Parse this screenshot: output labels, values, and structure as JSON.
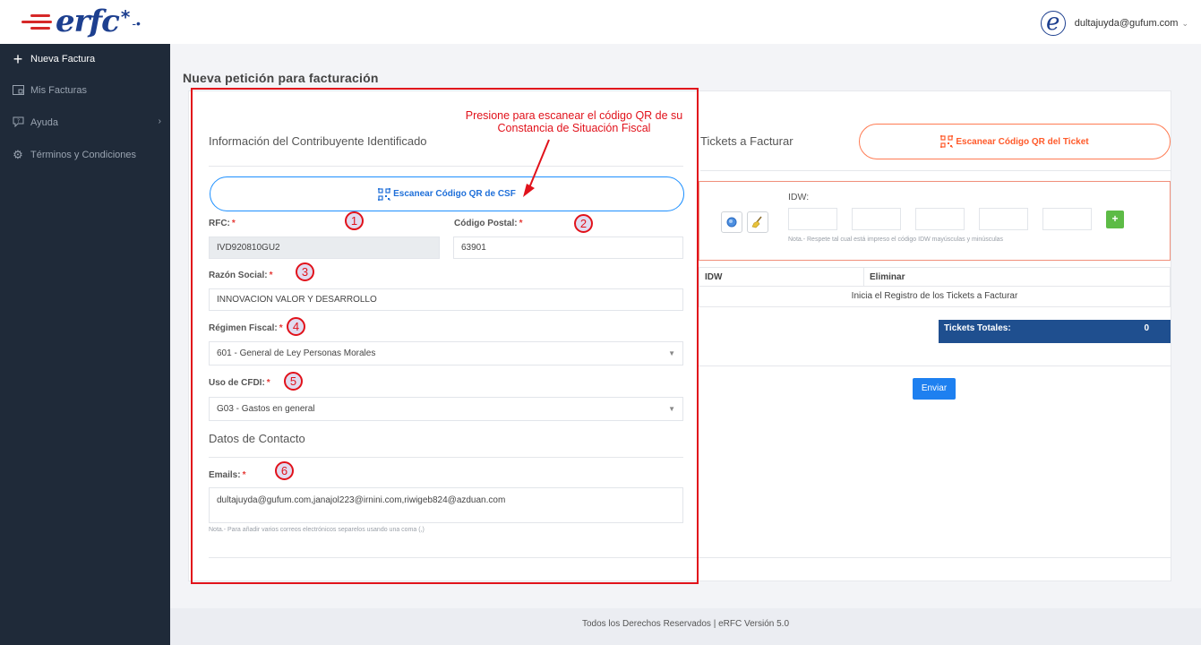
{
  "header": {
    "logo_text": "erfc",
    "logo_star": "*",
    "logo_dot": "-•",
    "user_avatar_letter": "e",
    "user_email": "dultajuyda@gufum.com",
    "user_caret": "⌄"
  },
  "sidebar": {
    "items": [
      {
        "label": "Nueva Factura",
        "icon": "plus-icon",
        "glyph": "+"
      },
      {
        "label": "Mis Facturas",
        "icon": "invoice-icon",
        "glyph": "▭"
      },
      {
        "label": "Ayuda",
        "icon": "help-icon",
        "glyph": "?",
        "arrow": "›"
      },
      {
        "label": "Términos y Condiciones",
        "icon": "gear-icon",
        "glyph": "⚙"
      }
    ]
  },
  "page": {
    "title": "Nueva petición para facturación"
  },
  "left_panel": {
    "title": "Información del Contribuyente Identificado",
    "scan_csf_label": "Escanear Código QR de CSF",
    "rfc_label": "RFC:",
    "rfc_value": "IVD920810GU2",
    "cp_label": "Código Postal:",
    "cp_value": "63901",
    "razon_label": "Razón Social:",
    "razon_value": "INNOVACION VALOR Y DESARROLLO",
    "regimen_label": "Régimen Fiscal:",
    "regimen_value": "601 - General de Ley Personas Morales",
    "uso_label": "Uso de CFDI:",
    "uso_value": "G03 - Gastos en general",
    "contact_title": "Datos de Contacto",
    "emails_label": "Emails:",
    "emails_value": "dultajuyda@gufum.com,janajol223@irnini.com,riwigeb824@azduan.com",
    "emails_note": "Nota.- Para añadir varios correos electrónicos separelos usando una coma (,)",
    "required_mark": "*"
  },
  "right_panel": {
    "title": "Tickets a Facturar",
    "scan_ticket_label": "Escanear Código QR del Ticket",
    "idw_label": "IDW:",
    "idw_note": "Nota.- Respete tal cual está impreso el código IDW mayúsculas y minúsculas",
    "add_label": "+",
    "table_headers": [
      "IDW",
      "Eliminar"
    ],
    "table_empty": "Inicia el Registro de los Tickets a Facturar",
    "totals_label": "Tickets Totales:",
    "totals_value": "0",
    "send_label": "Enviar"
  },
  "annotations": {
    "callout": "Presione para escanear el código QR de su Constancia de Situación Fiscal",
    "markers": [
      "1",
      "2",
      "3",
      "4",
      "5",
      "6"
    ]
  },
  "footer": {
    "text": "Todos los Derechos Reservados | eRFC Versión 5.0"
  },
  "colors": {
    "sidebar": "#1f2a39",
    "accent_blue": "#1e80f0",
    "accent_orange": "#ff5a2a",
    "annotation_red": "#e1121b",
    "totals_bg": "#1f4f8f"
  }
}
